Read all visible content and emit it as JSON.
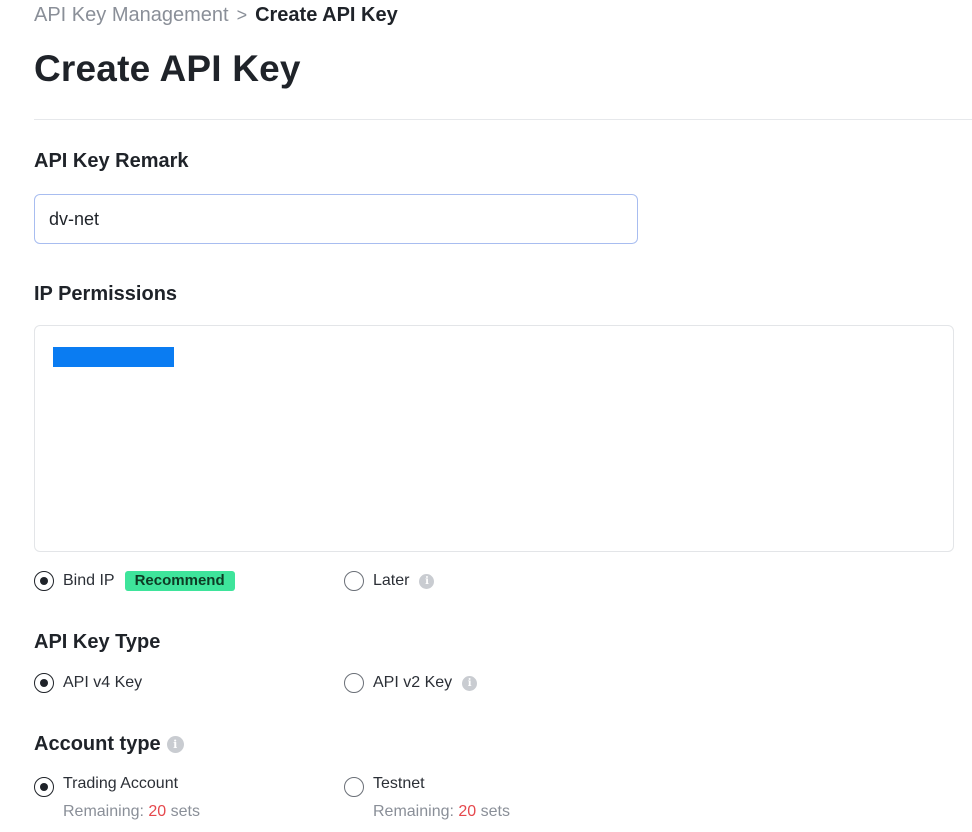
{
  "breadcrumb": {
    "parent": "API Key Management",
    "separator": ">",
    "current": "Create API Key"
  },
  "page_title": "Create API Key",
  "remark": {
    "label": "API Key Remark",
    "value": "dv-net"
  },
  "ip_permissions": {
    "label": "IP Permissions",
    "options": [
      {
        "label": "Bind IP",
        "badge": "Recommend",
        "checked": true
      },
      {
        "label": "Later",
        "checked": false,
        "info_icon": "info-icon"
      }
    ]
  },
  "key_type": {
    "label": "API Key Type",
    "options": [
      {
        "label": "API v4 Key",
        "checked": true
      },
      {
        "label": "API v2 Key",
        "checked": false,
        "info_icon": "info-icon"
      }
    ]
  },
  "account_type": {
    "label": "Account type",
    "info_icon": "info-icon",
    "options": [
      {
        "label": "Trading Account",
        "checked": true,
        "remaining_prefix": "Remaining:",
        "remaining_count": "20",
        "remaining_suffix": "sets"
      },
      {
        "label": "Testnet",
        "checked": false,
        "remaining_prefix": "Remaining:",
        "remaining_count": "20",
        "remaining_suffix": "sets"
      }
    ]
  },
  "colors": {
    "accent_badge": "#3ee49b",
    "remaining_number": "#e5484d",
    "input_border": "#a8bdf0",
    "redaction": "#0a7cf2"
  }
}
